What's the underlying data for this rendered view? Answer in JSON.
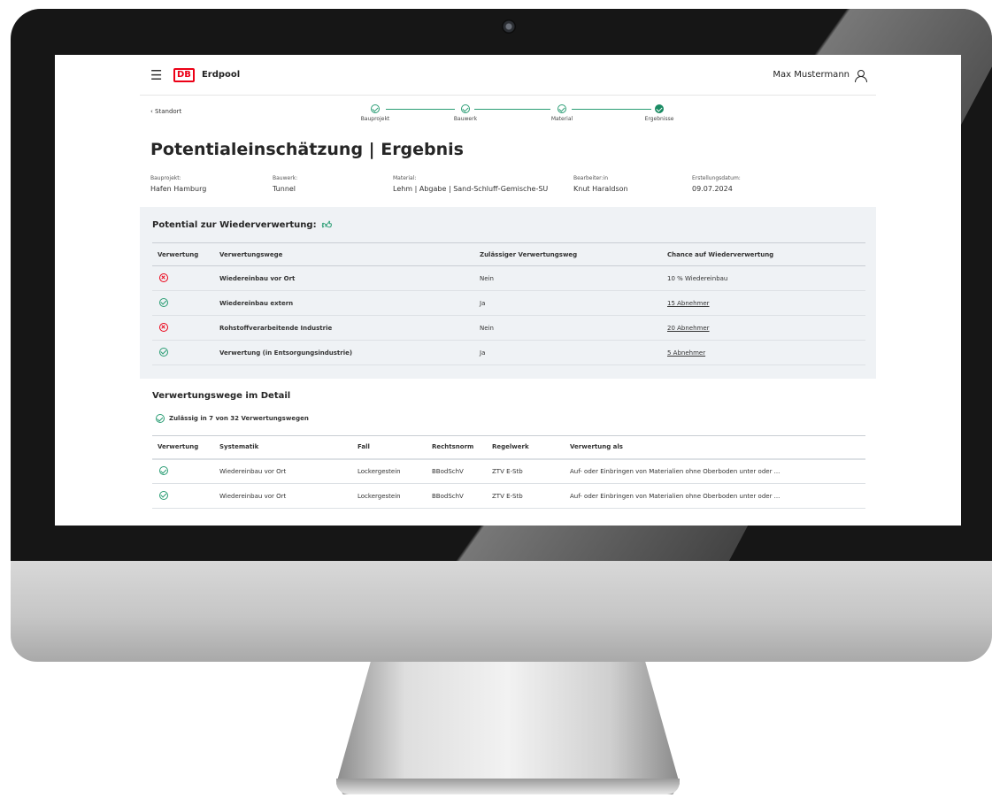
{
  "header": {
    "brand_logo": "DB",
    "brand": "Erdpool",
    "user_name": "Max Mustermann"
  },
  "nav": {
    "back_label": "‹ Standort"
  },
  "steps": [
    {
      "label": "Bauprojekt",
      "state": "done"
    },
    {
      "label": "Bauwerk",
      "state": "done"
    },
    {
      "label": "Material",
      "state": "done"
    },
    {
      "label": "Ergebnisse",
      "state": "active"
    }
  ],
  "page_title": "Potentialeinschätzung | Ergebnis",
  "meta": [
    {
      "key": "Bauprojekt:",
      "value": "Hafen Hamburg"
    },
    {
      "key": "Bauwerk:",
      "value": "Tunnel"
    },
    {
      "key": "Material:",
      "value": "Lehm | Abgabe | Sand-Schluff-Gemische-SU"
    },
    {
      "key": "Bearbeiter:in",
      "value": "Knut Haraldson"
    },
    {
      "key": "Erstellungsdatum:",
      "value": "09.07.2024"
    }
  ],
  "potential": {
    "title": "Potential zur Wiederverwertung:",
    "columns": [
      "Verwertung",
      "Verwertungswege",
      "Zulässiger Verwertungsweg",
      "Chance auf Wiederverwertung"
    ],
    "rows": [
      {
        "status": "no",
        "path": "Wiedereinbau vor Ort",
        "allowed": "Nein",
        "chance": "10 % Wiedereinbau",
        "link": false
      },
      {
        "status": "ok",
        "path": "Wiedereinbau extern",
        "allowed": "Ja",
        "chance": "15 Abnehmer",
        "link": true
      },
      {
        "status": "no",
        "path": "Rohstoffverarbeitende Industrie",
        "allowed": "Nein",
        "chance": "20 Abnehmer",
        "link": true
      },
      {
        "status": "ok",
        "path": "Verwertung (in Entsorgungsindustrie)",
        "allowed": "Ja",
        "chance": "5 Abnehmer",
        "link": true
      }
    ]
  },
  "detail": {
    "title": "Verwertungswege im Detail",
    "allowed_summary": "Zulässig in 7 von 32 Verwertungswegen",
    "columns": [
      "Verwertung",
      "Systematik",
      "Fall",
      "Rechtsnorm",
      "Regelwerk",
      "Verwertung als"
    ],
    "rows": [
      {
        "status": "ok",
        "systematik": "Wiedereinbau vor Ort",
        "fall": "Lockergestein",
        "rechtsnorm": "BBodSchV",
        "regelwerk": "ZTV E-Stb",
        "verwertung_als": "Auf- oder Einbringen von Materialien ohne Oberboden unter oder ..."
      },
      {
        "status": "ok",
        "systematik": "Wiedereinbau vor Ort",
        "fall": "Lockergestein",
        "rechtsnorm": "BBodSchV",
        "regelwerk": "ZTV E-Stb",
        "verwertung_als": "Auf- oder Einbringen von Materialien ohne Oberboden unter oder ..."
      }
    ]
  },
  "colors": {
    "accent_green": "#2a9d74",
    "db_red": "#ec0016",
    "panel_bg": "#eff2f5"
  }
}
